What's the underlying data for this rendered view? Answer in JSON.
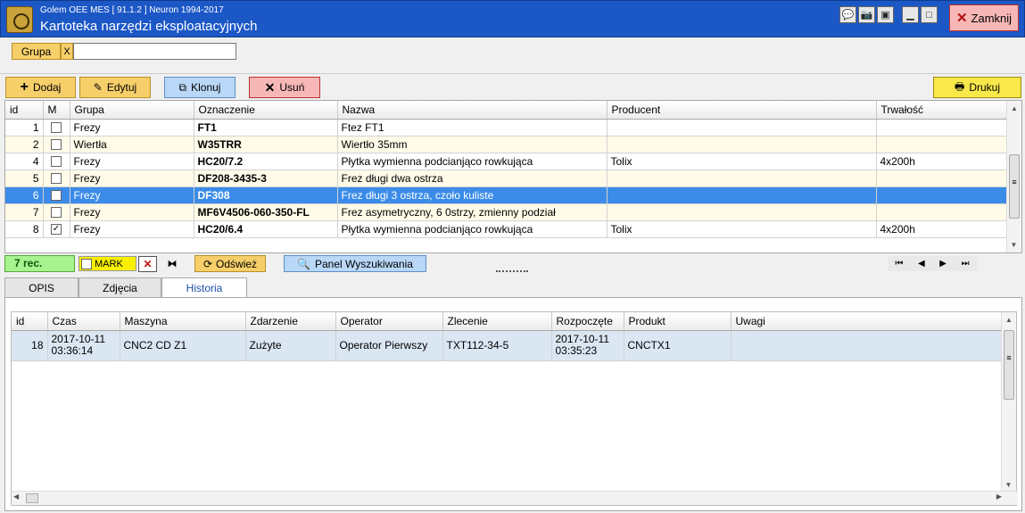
{
  "window": {
    "subtitle": "Golem OEE MES  [ 91.1.2 ]   Neuron 1994-2017",
    "title": "Kartoteka narzędzi eksploatacyjnych",
    "close_label": "Zamknij"
  },
  "filter": {
    "label": "Grupa",
    "clear": "X",
    "value": ""
  },
  "toolbar": {
    "add": "Dodaj",
    "edit": "Edytuj",
    "clone": "Klonuj",
    "delete": "Usuń",
    "print": "Drukuj"
  },
  "grid": {
    "headers": [
      "id",
      "M",
      "Grupa",
      "Oznaczenie",
      "Nazwa",
      "Producent",
      "Trwałość"
    ],
    "rows": [
      {
        "id": "1",
        "m": "",
        "group": "Frezy",
        "code": "FT1",
        "name": "Ftez FT1",
        "producer": "",
        "durability": ""
      },
      {
        "id": "2",
        "m": "",
        "group": "Wiertła",
        "code": "W35TRR",
        "name": "Wiertło 35mm",
        "producer": "",
        "durability": ""
      },
      {
        "id": "4",
        "m": "",
        "group": "Frezy",
        "code": "HC20/7.2",
        "name": "Płytka wymienna podcianjąco rowkująca",
        "producer": "Tolix",
        "durability": "4x200h"
      },
      {
        "id": "5",
        "m": "",
        "group": "Frezy",
        "code": "DF208-3435-3",
        "name": "Frez długi dwa ostrza",
        "producer": "",
        "durability": ""
      },
      {
        "id": "6",
        "m": "",
        "group": "Frezy",
        "code": "DF308",
        "name": "Frez długi 3 ostrza, czoło kuliste",
        "producer": "",
        "durability": ""
      },
      {
        "id": "7",
        "m": "",
        "group": "Frezy",
        "code": "MF6V4506-060-350-FL",
        "name": "Frez asymetryczny, 6 0strzy, zmienny podział",
        "producer": "",
        "durability": ""
      },
      {
        "id": "8",
        "m": "✓",
        "group": "Frezy",
        "code": "HC20/6.4",
        "name": "Płytka wymienna podcianjąco rowkująca",
        "producer": "Tolix",
        "durability": "4x200h"
      }
    ],
    "selected_index": 4
  },
  "status": {
    "records": "7 rec.",
    "mark": "MARK",
    "refresh": "Odśwież",
    "search_panel": "Panel Wyszukiwania"
  },
  "tabs": [
    "OPIS",
    "Zdjęcia",
    "Historia"
  ],
  "history": {
    "headers": [
      "id",
      "Czas",
      "Maszyna",
      "Zdarzenie",
      "Operator",
      "Zlecenie",
      "Rozpoczęte",
      "Produkt",
      "Uwagi"
    ],
    "rows": [
      {
        "id": "18",
        "time": "2017-10-11 03:36:14",
        "machine": "CNC2  CD Z1",
        "event": "Zużyte",
        "operator": "Operator Pierwszy",
        "order": "TXT112-34-5",
        "started": "2017-10-11 03:35:23",
        "product": "CNCTX1",
        "notes": ""
      }
    ]
  },
  "colors": {
    "titlebar": "#1c57c6",
    "selected_row": "#3b8ce8",
    "alt_row": "#fffbe8",
    "add_btn": "#f6cf6a",
    "clone_btn": "#b9d7f7",
    "delete_btn": "#f7b7b7"
  }
}
